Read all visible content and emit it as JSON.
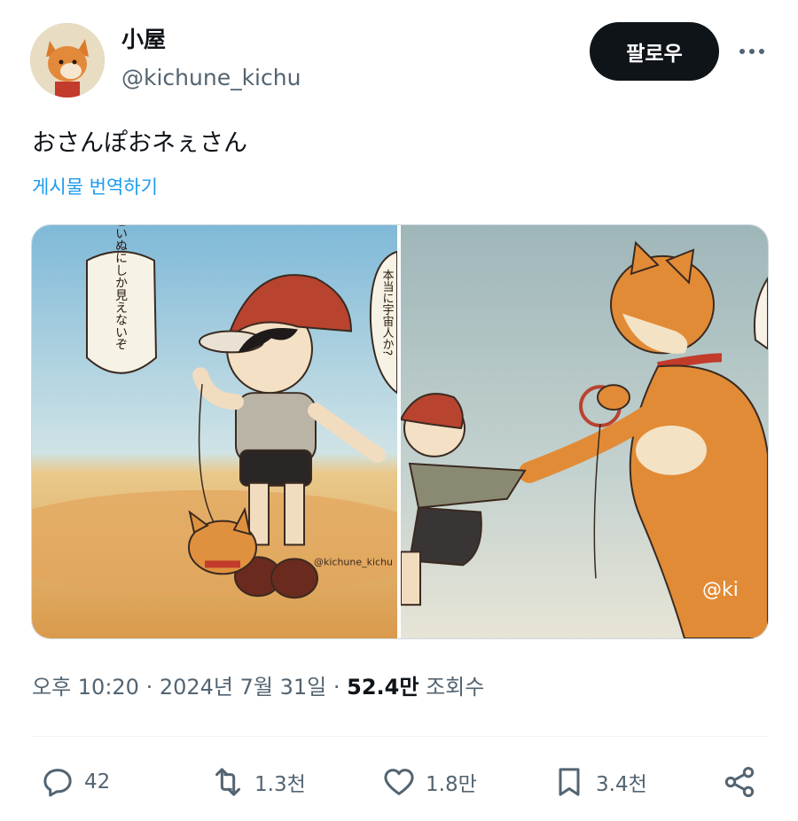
{
  "author": {
    "display_name": "小屋",
    "handle": "@kichune_kichu",
    "avatar_icon": "fox-avatar-icon"
  },
  "header": {
    "follow_label": "팔로우",
    "more_icon": "more-horizontal-icon"
  },
  "tweet": {
    "text": "おさんぽおネぇさん",
    "translate_label": "게시물 번역하기"
  },
  "media": {
    "left_bubble_text": "こいぬにしか見えないぞ",
    "left_bubble_partial_text": "本当に宇宙人か?",
    "left_signature": "@kichune_kichu",
    "right_signature": "@ki"
  },
  "meta": {
    "time": "오후 10:20",
    "separator": " · ",
    "date": "2024년 7월 31일",
    "views_count": "52.4만",
    "views_label": "조회수"
  },
  "actions": {
    "reply": {
      "icon": "reply-icon",
      "count": "42"
    },
    "repost": {
      "icon": "repost-icon",
      "count": "1.3천"
    },
    "like": {
      "icon": "heart-icon",
      "count": "1.8만"
    },
    "bookmark": {
      "icon": "bookmark-icon",
      "count": "3.4천"
    },
    "share": {
      "icon": "share-icon"
    }
  },
  "colors": {
    "text_primary": "#0f1419",
    "text_secondary": "#536471",
    "link": "#1d9bf0",
    "follow_bg": "#0f1419"
  }
}
